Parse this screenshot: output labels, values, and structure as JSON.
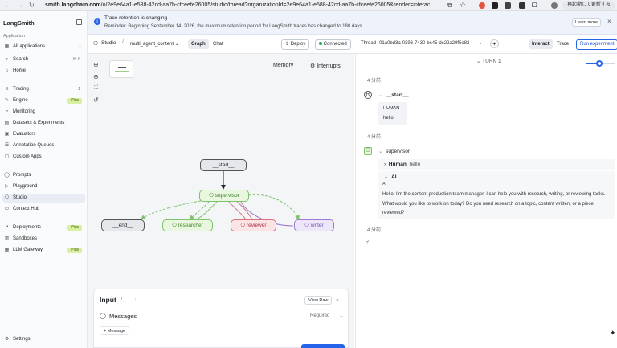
{
  "browser": {
    "url_host": "smith.langchain.com",
    "url_path": "/o/2e9e64a1-e588-42cd-aa7b-cfceefe26005/studio/thread?organizationId=2e9e64a1-e588-42cd-aa7b-cfceefe26005&render=interac...",
    "restart_label": "再起動して更新する"
  },
  "sidebar": {
    "logo": "LangSmith",
    "collapse_icon": "sidebar-collapse-icon",
    "section_label": "Application",
    "workspace": "All applications",
    "search": {
      "label": "Search",
      "shortcut": "⌘ K"
    },
    "home": "Home",
    "items": [
      {
        "label": "Tracing",
        "count": "1"
      },
      {
        "label": "Engine",
        "badge": "Plus"
      },
      {
        "label": "Monitoring"
      },
      {
        "label": "Datasets & Experiments"
      },
      {
        "label": "Evaluators"
      },
      {
        "label": "Annotation Queues"
      },
      {
        "label": "Custom Apps"
      },
      {
        "label": "Prompts"
      },
      {
        "label": "Playground"
      },
      {
        "label": "Studio"
      },
      {
        "label": "Context Hub"
      },
      {
        "label": "Deployments",
        "badge": "Plus"
      },
      {
        "label": "Sandboxes"
      },
      {
        "label": "LLM Gateway",
        "badge": "Plus"
      }
    ],
    "settings": "Settings"
  },
  "banner": {
    "title": "Trace retention is changing",
    "message": "Reminder: Beginning September 14, 2026, the maximum retention period for LangSmith traces has changed to 180 days.",
    "learn_more": "Learn more"
  },
  "toolbar": {
    "studio": "Studio",
    "graph_name": "multi_agent_content",
    "tab_graph": "Graph",
    "tab_chat": "Chat",
    "deploy": "Deploy",
    "connected": "Connected",
    "thread_label": "Thread",
    "thread_id": "01a0bd3a-0396-7430-bc45-dc22a29f5e82",
    "interact": "Interact",
    "trace": "Trace",
    "run_experiment": "Run experiment"
  },
  "canvas": {
    "memory": "Memory",
    "interrupts": "Interrupts",
    "nodes": {
      "start": "__start__",
      "supervisor": "supervisor",
      "end": "__end__",
      "researcher": "researcher",
      "reviewer": "reviewer",
      "writer": "writer"
    },
    "input": {
      "title": "Input",
      "view_raw": "View Raw",
      "messages": "Messages",
      "required": "Required",
      "add_message": "+ Message"
    }
  },
  "thread": {
    "turn_label": "TURN 1",
    "time_ago": "4 分前",
    "entries": [
      {
        "node": "__start__",
        "role": "HUMAN",
        "content": "hello"
      },
      {
        "node": "supervisor",
        "human_label": "Human",
        "human_content": "hello",
        "ai_header": "AI",
        "ai_role": "AI",
        "ai_content": "Hello! I'm the content production team manager. I can help you with research, writing, or reviewing tasks. What would you like to work on today? Do you need research on a topic, content written, or a piece reviewed?"
      }
    ]
  },
  "colors": {
    "accent": "#2563eb",
    "badge_bg": "#d9f0a3",
    "supervisor_bg": "#e8f7dd",
    "supervisor_border": "#7cc36b",
    "reviewer_bg": "#fbe3e6",
    "reviewer_border": "#d9707d",
    "writer_bg": "#eee6fa",
    "writer_border": "#9b7bd1"
  }
}
